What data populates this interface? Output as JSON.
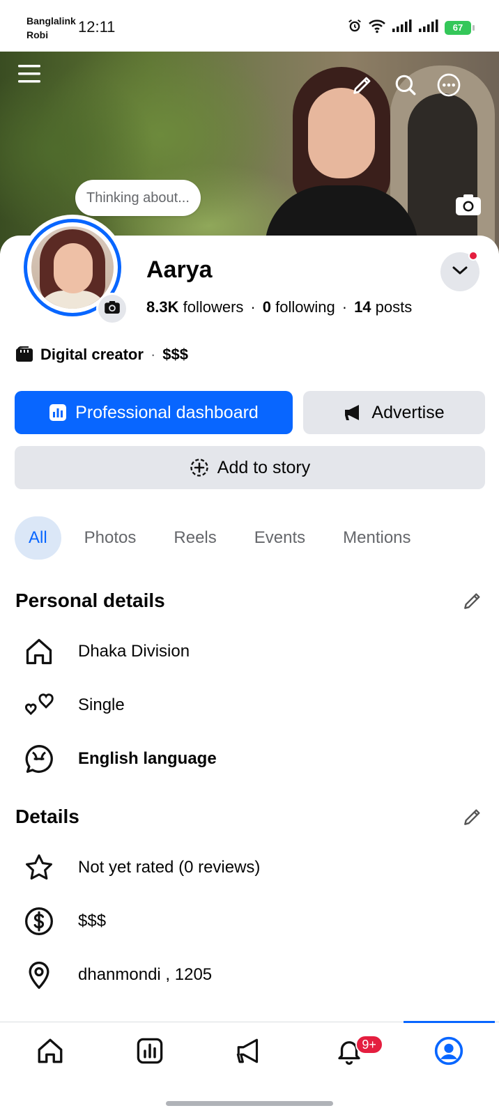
{
  "status_bar": {
    "carrier_1": "Banglalink",
    "carrier_2": "Robi",
    "time": "12:11",
    "battery": "67"
  },
  "cover": {
    "thinking_text": "Thinking about..."
  },
  "profile": {
    "name": "Aarya",
    "followers_count": "8.3K",
    "followers_label": "followers",
    "following_count": "0",
    "following_label": "following",
    "posts_count": "14",
    "posts_label": "posts",
    "stats_separator": "·",
    "category": "Digital creator",
    "price_range": "$$$",
    "category_separator": "·"
  },
  "actions": {
    "dashboard_label": "Professional dashboard",
    "advertise_label": "Advertise",
    "story_label": "Add to story"
  },
  "tabs": [
    {
      "label": "All",
      "active": true
    },
    {
      "label": "Photos",
      "active": false
    },
    {
      "label": "Reels",
      "active": false
    },
    {
      "label": "Events",
      "active": false
    },
    {
      "label": "Mentions",
      "active": false
    }
  ],
  "personal_details": {
    "title": "Personal details",
    "items": [
      {
        "icon": "home-icon",
        "text": "Dhaka Division"
      },
      {
        "icon": "hearts-icon",
        "text": "Single"
      },
      {
        "icon": "language-icon",
        "text": "English language"
      }
    ]
  },
  "details": {
    "title": "Details",
    "items": [
      {
        "icon": "star-icon",
        "text": "Not yet rated (0 reviews)"
      },
      {
        "icon": "dollar-icon",
        "text": "$$$"
      },
      {
        "icon": "location-pin-icon",
        "text": "dhanmondi , 1205"
      }
    ]
  },
  "bottom_nav": {
    "items": [
      "home-icon",
      "dashboard-icon",
      "megaphone-icon",
      "bell-icon",
      "profile-icon"
    ],
    "notification_badge": "9+",
    "active_index": 4
  },
  "colors": {
    "accent": "#0866ff",
    "button_gray": "#e4e6eb",
    "badge_red": "#e41e3f",
    "battery_green": "#34c759"
  }
}
